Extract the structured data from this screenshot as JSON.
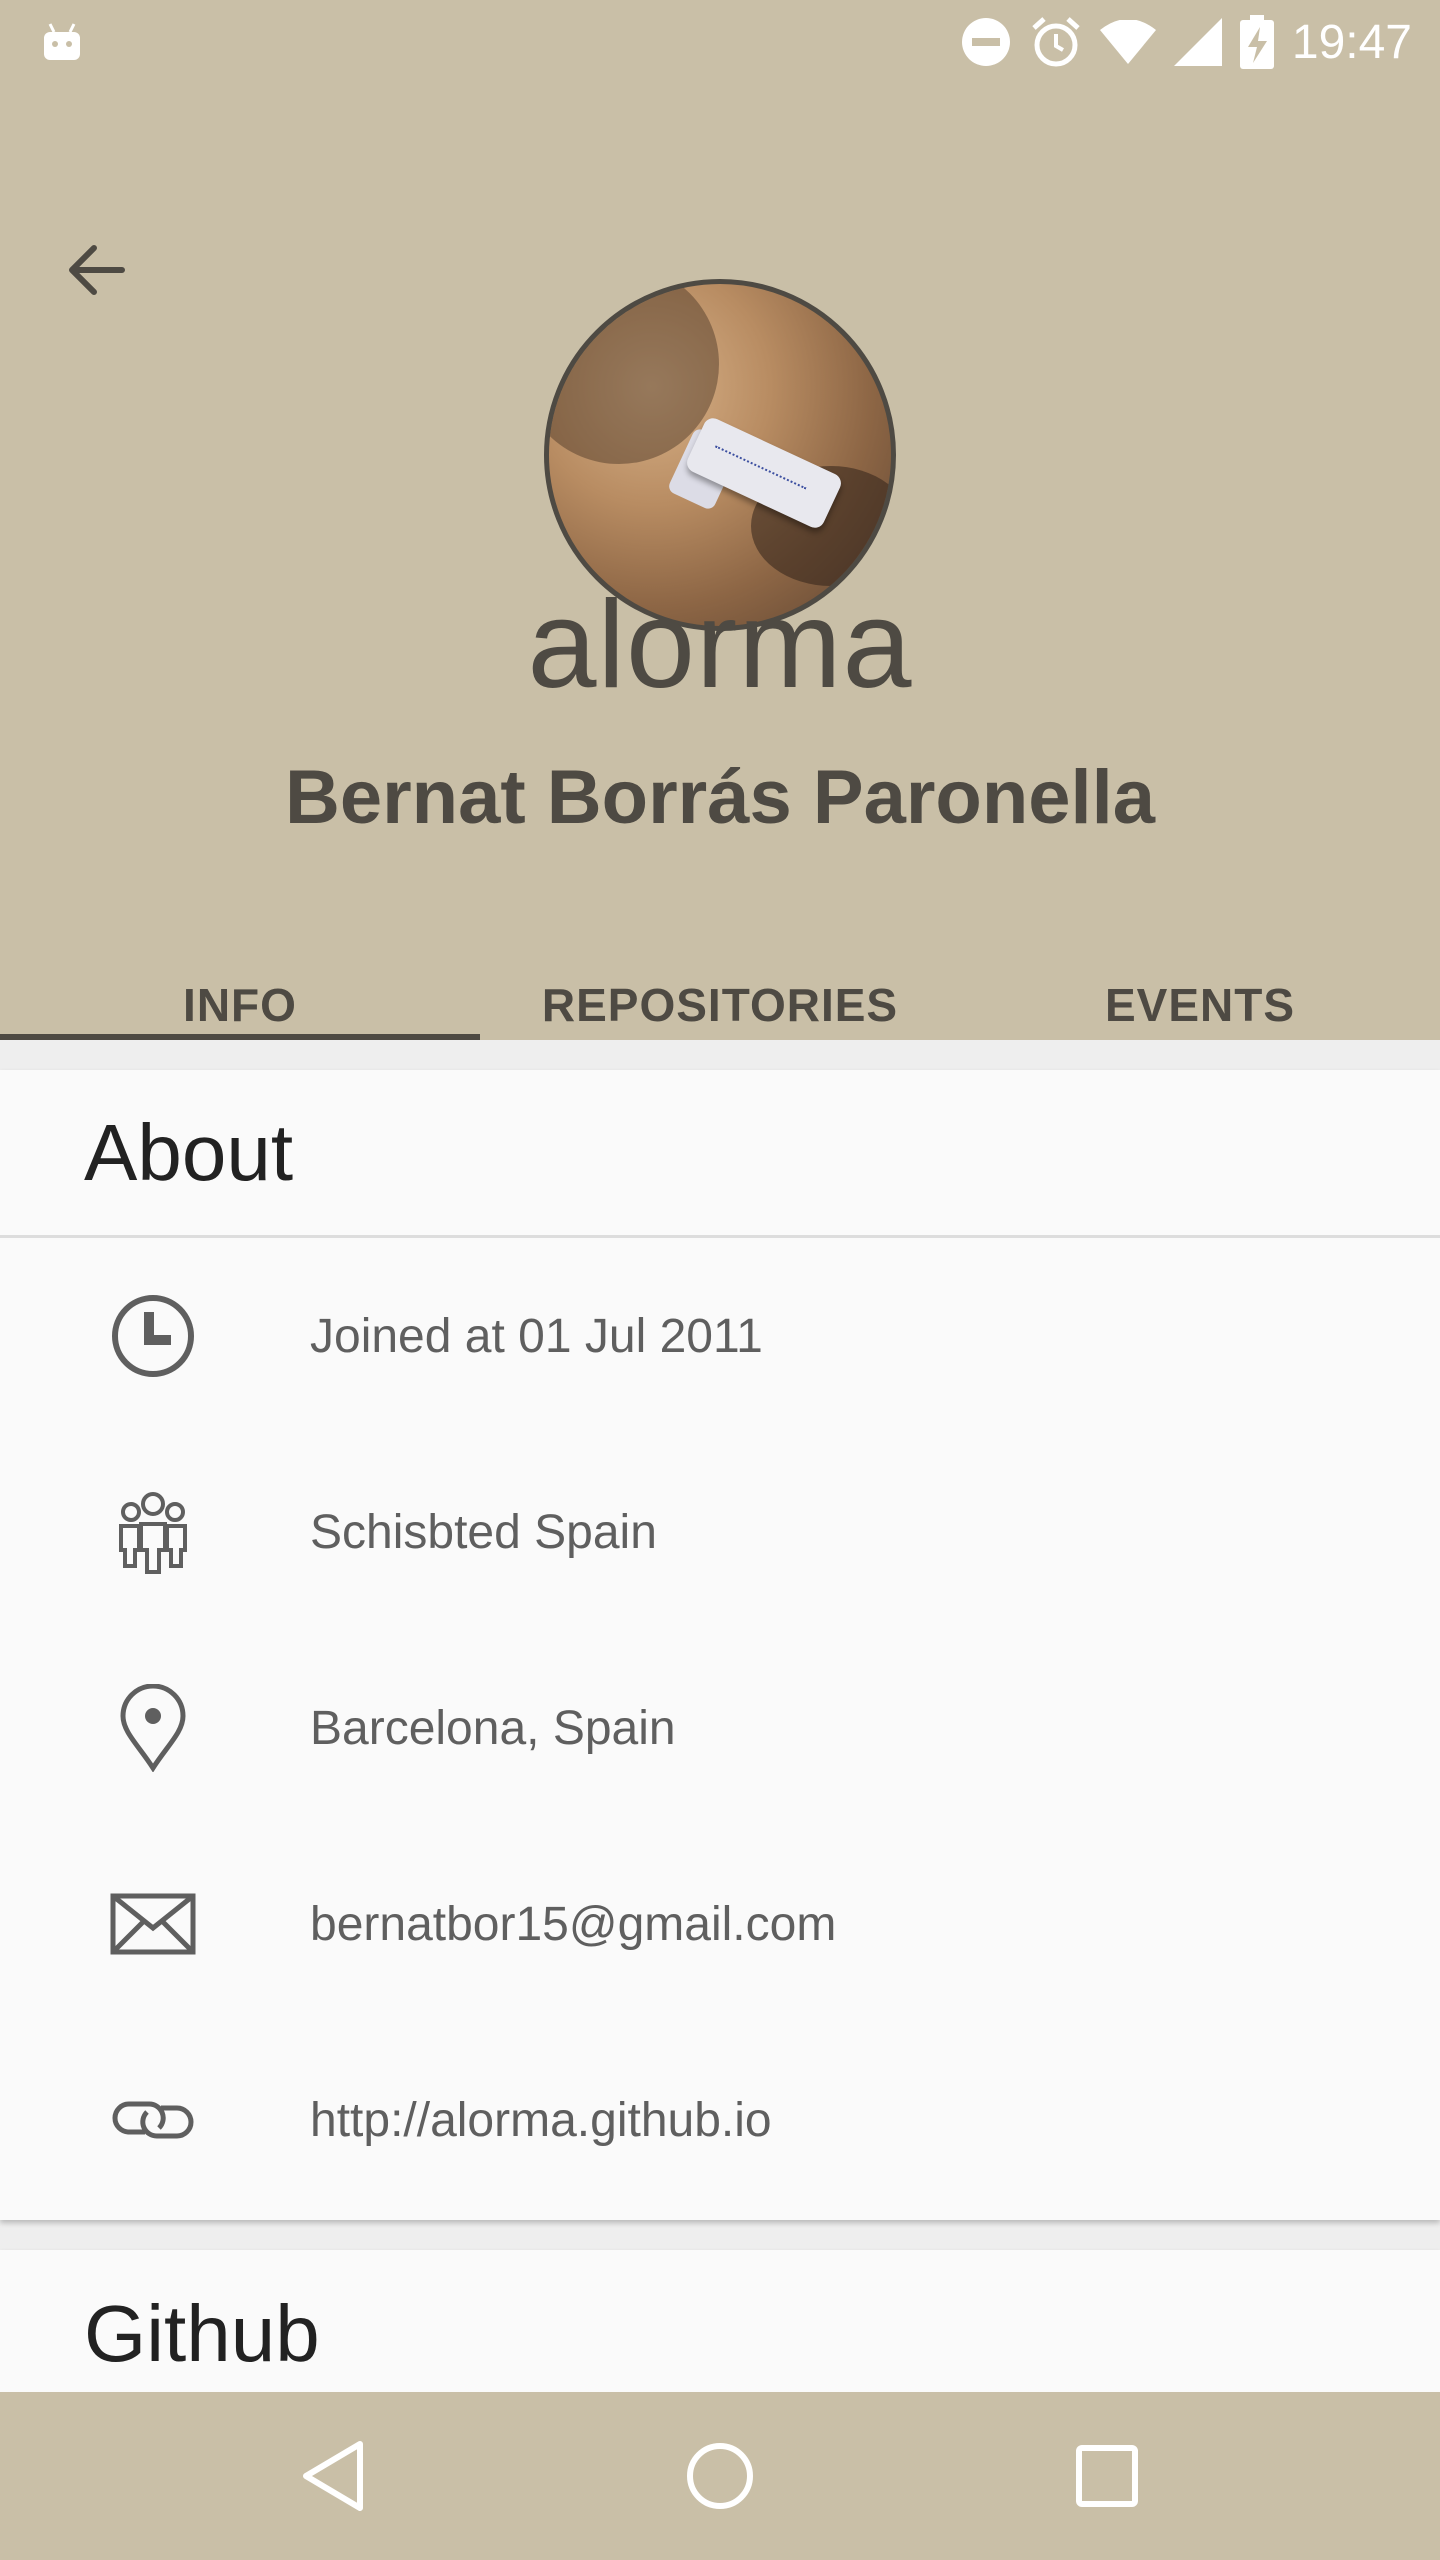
{
  "status_bar": {
    "time": "19:47",
    "icons": [
      "android-icon",
      "do-not-disturb-icon",
      "alarm-icon",
      "wifi-icon",
      "signal-icon",
      "battery-charging-icon"
    ]
  },
  "profile": {
    "username": "alorma",
    "full_name": "Bernat Borrás Paronella",
    "avatar": "user-avatar-photo"
  },
  "tabs": [
    {
      "label": "INFO",
      "selected": true
    },
    {
      "label": "REPOSITORIES",
      "selected": false
    },
    {
      "label": "EVENTS",
      "selected": false
    }
  ],
  "about": {
    "title": "About",
    "items": [
      {
        "icon": "clock-icon",
        "text": "Joined at 01 Jul 2011"
      },
      {
        "icon": "people-icon",
        "text": "Schisbted Spain"
      },
      {
        "icon": "location-pin-icon",
        "text": "Barcelona, Spain"
      },
      {
        "icon": "mail-icon",
        "text": "bernatbor15@gmail.com"
      },
      {
        "icon": "link-icon",
        "text": "http://alorma.github.io"
      }
    ]
  },
  "github": {
    "title": "Github"
  },
  "nav_bar": {
    "buttons": [
      "back-nav-icon",
      "home-nav-icon",
      "recents-nav-icon"
    ]
  },
  "colors": {
    "header_bg": "#c9bfa7",
    "header_text": "#4e4a43",
    "card_bg": "#fafafa",
    "content_bg": "#eeeeee"
  }
}
